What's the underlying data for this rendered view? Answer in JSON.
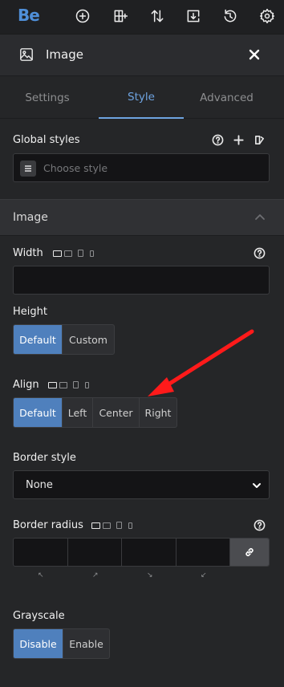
{
  "topbar": {
    "logo": "Be",
    "icons": [
      "plus-circle-icon",
      "add-section-icon",
      "sort-icon",
      "import-icon",
      "history-icon",
      "gear-icon"
    ]
  },
  "panel": {
    "title": "Image",
    "icon": "image-icon",
    "close_icon": "close-icon"
  },
  "tabs": [
    {
      "label": "Settings",
      "active": false
    },
    {
      "label": "Style",
      "active": true
    },
    {
      "label": "Advanced",
      "active": false
    }
  ],
  "global_styles": {
    "label": "Global styles",
    "placeholder": "Choose style"
  },
  "section": {
    "title": "Image",
    "expanded": true
  },
  "width": {
    "label": "Width",
    "value": ""
  },
  "height": {
    "label": "Height",
    "options": [
      "Default",
      "Custom"
    ],
    "selected": "Default"
  },
  "align": {
    "label": "Align",
    "options": [
      "Default",
      "Left",
      "Center",
      "Right"
    ],
    "selected": "Default"
  },
  "border_style": {
    "label": "Border style",
    "value": "None"
  },
  "border_radius": {
    "label": "Border radius",
    "values": [
      "",
      "",
      "",
      ""
    ],
    "corner_glyphs": [
      "↖",
      "↗",
      "↘",
      "↙"
    ]
  },
  "grayscale": {
    "label": "Grayscale",
    "options": [
      "Disable",
      "Enable"
    ],
    "selected": "Disable"
  },
  "colors": {
    "accent": "#4f80bd",
    "tab_active": "#6ea3e0",
    "logo": "#4f8fd8",
    "annotation_arrow": "#ff1a1a"
  }
}
